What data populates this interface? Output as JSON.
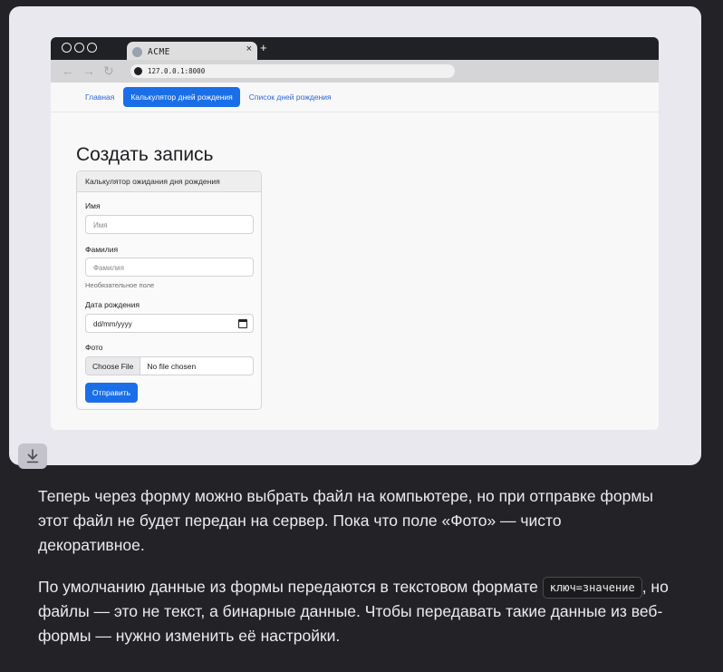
{
  "browser": {
    "tab_title": "ACME",
    "tab_close": "×",
    "new_tab": "+",
    "url": "127.0.0.1:8000",
    "nav_back": "←",
    "nav_forward": "→",
    "nav_reload": "↻"
  },
  "site_nav": {
    "items": [
      {
        "label": "Главная",
        "active": false
      },
      {
        "label": "Калькулятор дней рождения",
        "active": true
      },
      {
        "label": "Список дней рождения",
        "active": false
      }
    ]
  },
  "page": {
    "title": "Создать запись",
    "card_header": "Калькулятор ожидания дня рождения",
    "fields": {
      "first_name_label": "Имя",
      "first_name_placeholder": "Имя",
      "last_name_label": "Фамилия",
      "last_name_placeholder": "Фамилия",
      "last_name_help": "Необязательное поле",
      "birthday_label": "Дата рождения",
      "birthday_value": "dd/mm/yyyy",
      "photo_label": "Фото",
      "choose_file": "Choose File",
      "no_file": "No file chosen"
    },
    "submit_label": "Отправить"
  },
  "article": {
    "para1": "Теперь через форму можно выбрать файл на компьютере, но при отправке формы этот файл не будет передан на сервер. Пока что поле «Фото» — чисто декоративное.",
    "para2_before": "По умолчанию данные из формы передаются в текстовом формате ",
    "para2_code": "ключ=значение",
    "para2_after": ", но файлы — это не текст, а бинарные данные. Чтобы передавать такие данные из веб-формы — нужно изменить её настройки."
  },
  "colors": {
    "accent": "#1a6fe8",
    "page_bg": "#232327",
    "card_bg": "#e9e8ee"
  },
  "icons": [
    "download-icon",
    "back-arrow-icon",
    "forward-arrow-icon",
    "reload-icon",
    "calendar-icon"
  ]
}
